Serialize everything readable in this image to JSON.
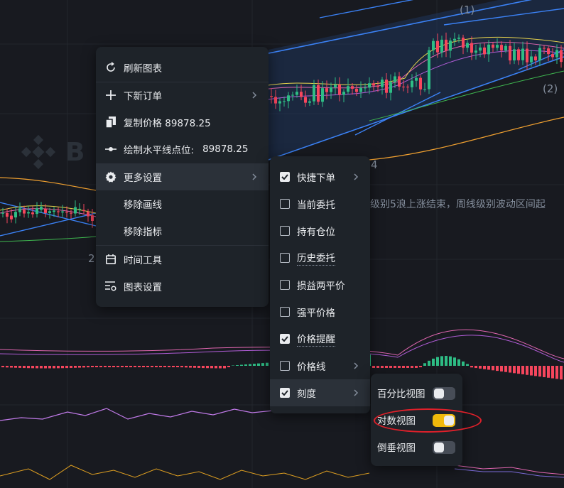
{
  "chart": {
    "wave_labels": [
      "(1)",
      "(2)",
      "4",
      "2"
    ],
    "annotation": "级别5浪上涨结束，周线级别波动区间起",
    "watermark": "B"
  },
  "context_menu": {
    "items": [
      {
        "label": "刷新图表",
        "icon": "refresh-icon"
      },
      {
        "label": "下新订单",
        "icon": "plus-icon",
        "has_submenu": true
      },
      {
        "label": "复制价格 89878.25",
        "icon": "copy-icon"
      },
      {
        "label": "绘制水平线点位:",
        "value": "89878.25",
        "icon": "horizontal-line-icon"
      },
      {
        "label": "更多设置",
        "icon": "gear-icon",
        "has_submenu": true,
        "highlighted": true
      },
      {
        "label": "移除画线"
      },
      {
        "label": "移除指标"
      },
      {
        "label": "时间工具",
        "icon": "calendar-icon"
      },
      {
        "label": "图表设置",
        "icon": "chart-settings-icon"
      }
    ]
  },
  "more_settings_menu": {
    "items": [
      {
        "label": "快捷下单",
        "checked": true,
        "has_submenu": true
      },
      {
        "label": "当前委托",
        "checked": false
      },
      {
        "label": "持有仓位",
        "checked": false
      },
      {
        "label": "历史委托",
        "checked": false,
        "dotted": true
      },
      {
        "label": "损益两平价",
        "checked": false
      },
      {
        "label": "强平价格",
        "checked": false
      },
      {
        "label": "价格提醒",
        "checked": true,
        "dotted": true
      },
      {
        "label": "价格线",
        "checked": false,
        "has_submenu": true
      },
      {
        "label": "刻度",
        "checked": true,
        "has_submenu": true,
        "highlighted": true
      }
    ]
  },
  "scale_menu": {
    "items": [
      {
        "label": "百分比视图",
        "on": false
      },
      {
        "label": "对数视图",
        "on": true
      },
      {
        "label": "倒垂视图",
        "on": false
      }
    ]
  },
  "colors": {
    "background": "#181a20",
    "menu_bg": "#1e2329",
    "highlight": "#2b3139",
    "accent_yellow": "#f0b90b",
    "up_green": "#2ebd85",
    "down_red": "#f6465d",
    "annotation_ellipse": "#e0202a"
  }
}
